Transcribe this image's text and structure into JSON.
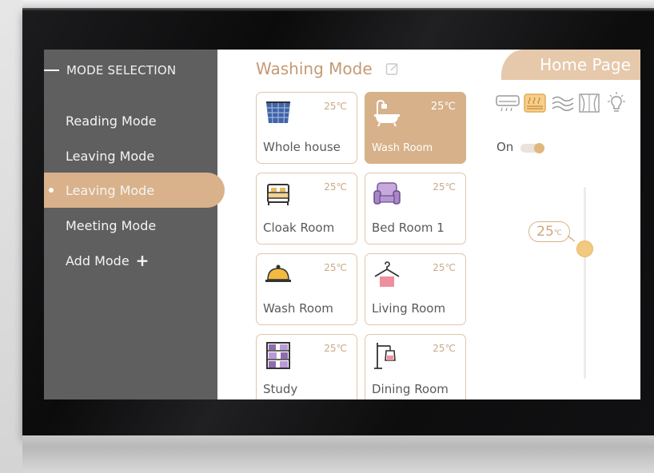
{
  "sidebar": {
    "header": "MODE SELECTION",
    "items": [
      {
        "label": "Reading Mode"
      },
      {
        "label": "Leaving Mode"
      },
      {
        "label": "Leaving Mode"
      },
      {
        "label": "Meeting Mode"
      },
      {
        "label": "Add Mode"
      }
    ],
    "active_index": 2
  },
  "main": {
    "title": "Washing Mode",
    "home_button": "Home Page",
    "rooms": [
      {
        "name": "Whole house",
        "temp": "25℃",
        "icon": "window-icon"
      },
      {
        "name": "Wash Room",
        "temp": "25℃",
        "icon": "bathtub-icon"
      },
      {
        "name": "Cloak Room",
        "temp": "25℃",
        "icon": "bed-icon"
      },
      {
        "name": "Bed Room 1",
        "temp": "25℃",
        "icon": "armchair-icon"
      },
      {
        "name": "Wash Room",
        "temp": "25℃",
        "icon": "cloche-icon"
      },
      {
        "name": "Living Room",
        "temp": "25℃",
        "icon": "hanger-icon"
      },
      {
        "name": "Study",
        "temp": "25℃",
        "icon": "bookshelf-icon"
      },
      {
        "name": "Dining Room",
        "temp": "25℃",
        "icon": "floor-lamp-icon"
      }
    ],
    "active_room_index": 1
  },
  "controls": {
    "devices": [
      "air-conditioner-icon",
      "floor-heating-icon",
      "ventilation-icon",
      "curtain-icon",
      "light-bulb-icon"
    ],
    "active_device_index": 1,
    "power_label": "On",
    "power_on": true,
    "temperature_value": "25",
    "temperature_unit": "℃",
    "slider_level": 0.3
  },
  "colors": {
    "accent": "#d9b28b",
    "sidebar": "#5f5f5f",
    "title": "#c49a73",
    "knob": "#f2ca7f"
  }
}
